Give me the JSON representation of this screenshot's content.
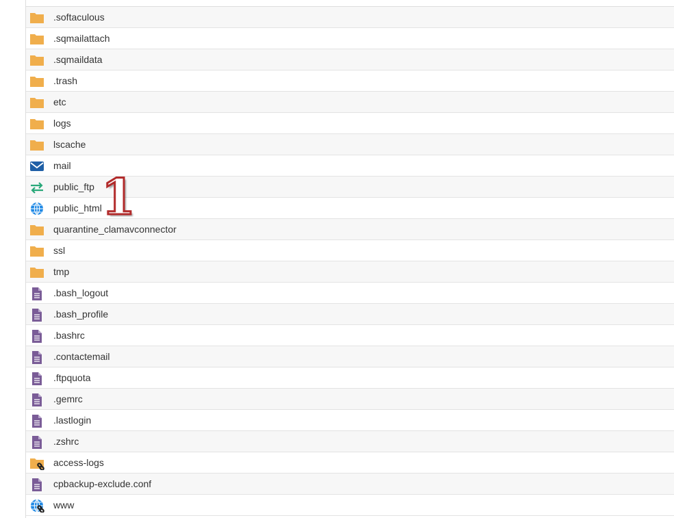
{
  "colors": {
    "folder": "#f0ae4c",
    "file": "#7a5c97",
    "mail": "#1f5fa6",
    "ftp": "#2aa87a",
    "globe": "#1e88e5",
    "link": "#222222"
  },
  "files": [
    {
      "name": ".softaculous",
      "icon": "folder"
    },
    {
      "name": ".sqmailattach",
      "icon": "folder"
    },
    {
      "name": ".sqmaildata",
      "icon": "folder"
    },
    {
      "name": ".trash",
      "icon": "folder"
    },
    {
      "name": "etc",
      "icon": "folder"
    },
    {
      "name": "logs",
      "icon": "folder"
    },
    {
      "name": "lscache",
      "icon": "folder"
    },
    {
      "name": "mail",
      "icon": "mail"
    },
    {
      "name": "public_ftp",
      "icon": "ftp"
    },
    {
      "name": "public_html",
      "icon": "globe"
    },
    {
      "name": "quarantine_clamavconnector",
      "icon": "folder"
    },
    {
      "name": "ssl",
      "icon": "folder"
    },
    {
      "name": "tmp",
      "icon": "folder"
    },
    {
      "name": ".bash_logout",
      "icon": "file"
    },
    {
      "name": ".bash_profile",
      "icon": "file"
    },
    {
      "name": ".bashrc",
      "icon": "file"
    },
    {
      "name": ".contactemail",
      "icon": "file"
    },
    {
      "name": ".ftpquota",
      "icon": "file"
    },
    {
      "name": ".gemrc",
      "icon": "file"
    },
    {
      "name": ".lastlogin",
      "icon": "file"
    },
    {
      "name": ".zshrc",
      "icon": "file"
    },
    {
      "name": "access-logs",
      "icon": "folder-link"
    },
    {
      "name": "cpbackup-exclude.conf",
      "icon": "file"
    },
    {
      "name": "www",
      "icon": "globe-link"
    }
  ],
  "annotation": "1"
}
